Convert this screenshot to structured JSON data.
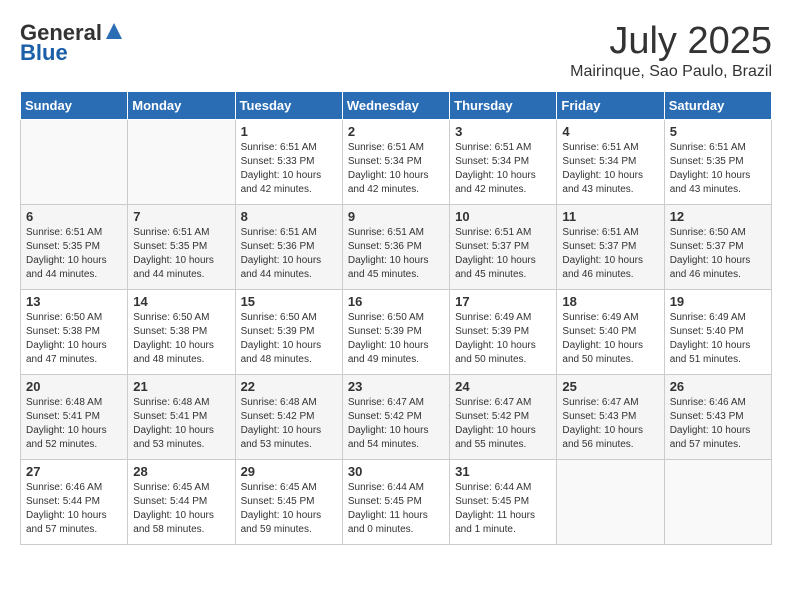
{
  "header": {
    "logo_general": "General",
    "logo_blue": "Blue",
    "title": "July 2025",
    "location": "Mairinque, Sao Paulo, Brazil"
  },
  "weekdays": [
    "Sunday",
    "Monday",
    "Tuesday",
    "Wednesday",
    "Thursday",
    "Friday",
    "Saturday"
  ],
  "weeks": [
    [
      {
        "day": "",
        "info": ""
      },
      {
        "day": "",
        "info": ""
      },
      {
        "day": "1",
        "info": "Sunrise: 6:51 AM\nSunset: 5:33 PM\nDaylight: 10 hours and 42 minutes."
      },
      {
        "day": "2",
        "info": "Sunrise: 6:51 AM\nSunset: 5:34 PM\nDaylight: 10 hours and 42 minutes."
      },
      {
        "day": "3",
        "info": "Sunrise: 6:51 AM\nSunset: 5:34 PM\nDaylight: 10 hours and 42 minutes."
      },
      {
        "day": "4",
        "info": "Sunrise: 6:51 AM\nSunset: 5:34 PM\nDaylight: 10 hours and 43 minutes."
      },
      {
        "day": "5",
        "info": "Sunrise: 6:51 AM\nSunset: 5:35 PM\nDaylight: 10 hours and 43 minutes."
      }
    ],
    [
      {
        "day": "6",
        "info": "Sunrise: 6:51 AM\nSunset: 5:35 PM\nDaylight: 10 hours and 44 minutes."
      },
      {
        "day": "7",
        "info": "Sunrise: 6:51 AM\nSunset: 5:35 PM\nDaylight: 10 hours and 44 minutes."
      },
      {
        "day": "8",
        "info": "Sunrise: 6:51 AM\nSunset: 5:36 PM\nDaylight: 10 hours and 44 minutes."
      },
      {
        "day": "9",
        "info": "Sunrise: 6:51 AM\nSunset: 5:36 PM\nDaylight: 10 hours and 45 minutes."
      },
      {
        "day": "10",
        "info": "Sunrise: 6:51 AM\nSunset: 5:37 PM\nDaylight: 10 hours and 45 minutes."
      },
      {
        "day": "11",
        "info": "Sunrise: 6:51 AM\nSunset: 5:37 PM\nDaylight: 10 hours and 46 minutes."
      },
      {
        "day": "12",
        "info": "Sunrise: 6:50 AM\nSunset: 5:37 PM\nDaylight: 10 hours and 46 minutes."
      }
    ],
    [
      {
        "day": "13",
        "info": "Sunrise: 6:50 AM\nSunset: 5:38 PM\nDaylight: 10 hours and 47 minutes."
      },
      {
        "day": "14",
        "info": "Sunrise: 6:50 AM\nSunset: 5:38 PM\nDaylight: 10 hours and 48 minutes."
      },
      {
        "day": "15",
        "info": "Sunrise: 6:50 AM\nSunset: 5:39 PM\nDaylight: 10 hours and 48 minutes."
      },
      {
        "day": "16",
        "info": "Sunrise: 6:50 AM\nSunset: 5:39 PM\nDaylight: 10 hours and 49 minutes."
      },
      {
        "day": "17",
        "info": "Sunrise: 6:49 AM\nSunset: 5:39 PM\nDaylight: 10 hours and 50 minutes."
      },
      {
        "day": "18",
        "info": "Sunrise: 6:49 AM\nSunset: 5:40 PM\nDaylight: 10 hours and 50 minutes."
      },
      {
        "day": "19",
        "info": "Sunrise: 6:49 AM\nSunset: 5:40 PM\nDaylight: 10 hours and 51 minutes."
      }
    ],
    [
      {
        "day": "20",
        "info": "Sunrise: 6:48 AM\nSunset: 5:41 PM\nDaylight: 10 hours and 52 minutes."
      },
      {
        "day": "21",
        "info": "Sunrise: 6:48 AM\nSunset: 5:41 PM\nDaylight: 10 hours and 53 minutes."
      },
      {
        "day": "22",
        "info": "Sunrise: 6:48 AM\nSunset: 5:42 PM\nDaylight: 10 hours and 53 minutes."
      },
      {
        "day": "23",
        "info": "Sunrise: 6:47 AM\nSunset: 5:42 PM\nDaylight: 10 hours and 54 minutes."
      },
      {
        "day": "24",
        "info": "Sunrise: 6:47 AM\nSunset: 5:42 PM\nDaylight: 10 hours and 55 minutes."
      },
      {
        "day": "25",
        "info": "Sunrise: 6:47 AM\nSunset: 5:43 PM\nDaylight: 10 hours and 56 minutes."
      },
      {
        "day": "26",
        "info": "Sunrise: 6:46 AM\nSunset: 5:43 PM\nDaylight: 10 hours and 57 minutes."
      }
    ],
    [
      {
        "day": "27",
        "info": "Sunrise: 6:46 AM\nSunset: 5:44 PM\nDaylight: 10 hours and 57 minutes."
      },
      {
        "day": "28",
        "info": "Sunrise: 6:45 AM\nSunset: 5:44 PM\nDaylight: 10 hours and 58 minutes."
      },
      {
        "day": "29",
        "info": "Sunrise: 6:45 AM\nSunset: 5:45 PM\nDaylight: 10 hours and 59 minutes."
      },
      {
        "day": "30",
        "info": "Sunrise: 6:44 AM\nSunset: 5:45 PM\nDaylight: 11 hours and 0 minutes."
      },
      {
        "day": "31",
        "info": "Sunrise: 6:44 AM\nSunset: 5:45 PM\nDaylight: 11 hours and 1 minute."
      },
      {
        "day": "",
        "info": ""
      },
      {
        "day": "",
        "info": ""
      }
    ]
  ]
}
